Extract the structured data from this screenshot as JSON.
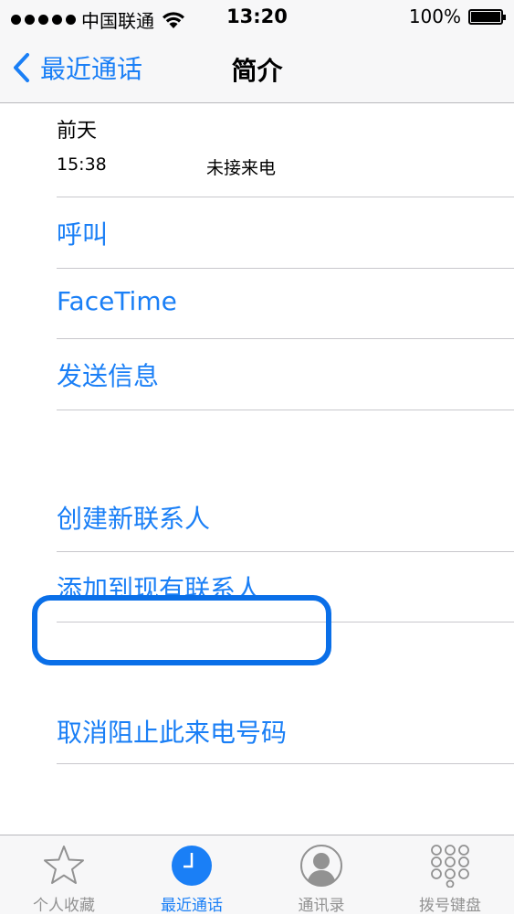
{
  "status_bar": {
    "carrier": "中国联通",
    "time": "13:20",
    "battery": "100%",
    "battery_level": 1.0
  },
  "nav": {
    "back_label": "最近通话",
    "title": "简介"
  },
  "call_info": {
    "date": "前天",
    "time": "15:38",
    "type": "未接来电"
  },
  "actions": {
    "call": "呼叫",
    "facetime": "FaceTime",
    "send_message": "发送信息",
    "create_contact": "创建新联系人",
    "add_existing": "添加到现有联系人",
    "unblock": "取消阻止此来电号码"
  },
  "tabs": [
    {
      "label": "个人收藏",
      "icon": "star-icon",
      "active": false
    },
    {
      "label": "最近通话",
      "icon": "clock-icon",
      "active": true
    },
    {
      "label": "通讯录",
      "icon": "contact-icon",
      "active": false
    },
    {
      "label": "拨号键盘",
      "icon": "keypad-icon",
      "active": false
    }
  ],
  "colors": {
    "accent": "#1a7ff6",
    "highlight": "#0a6fe8",
    "inactive_tab": "#929292"
  }
}
